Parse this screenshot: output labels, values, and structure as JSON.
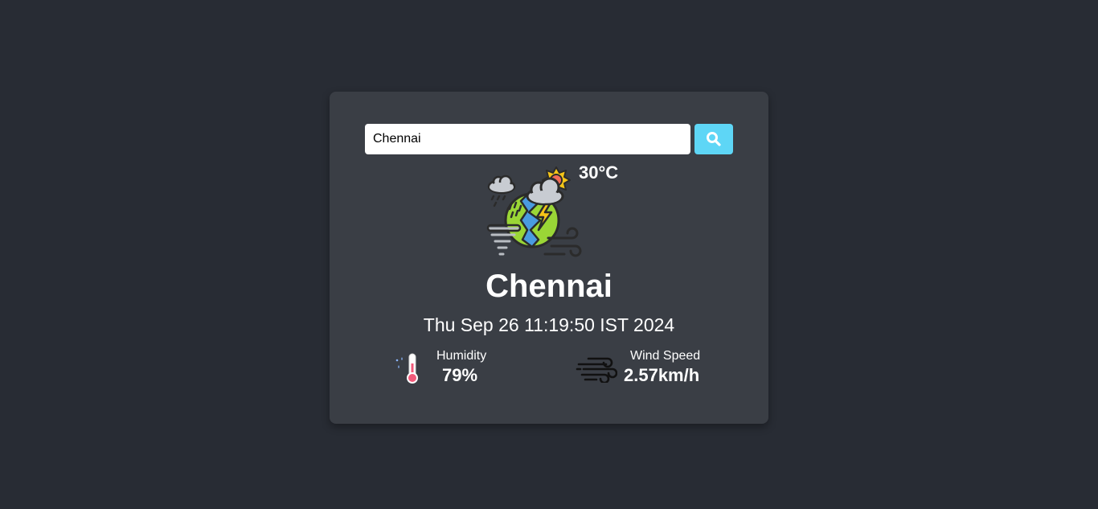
{
  "search": {
    "value": "Chennai",
    "icon": "search-icon"
  },
  "weather": {
    "icon": "thunderstorm-weather-icon",
    "temperature": "30°C",
    "city": "Chennai",
    "datetime": "Thu Sep 26 11:19:50 IST 2024"
  },
  "stats": {
    "humidity": {
      "label": "Humidity",
      "value": "79%",
      "icon": "thermometer-icon"
    },
    "wind": {
      "label": "Wind Speed",
      "value": "2.57km/h",
      "icon": "wind-icon"
    }
  },
  "colors": {
    "background": "#282c34",
    "card": "#3a3e45",
    "accent": "#5ed6f6",
    "text": "#ffffff"
  }
}
